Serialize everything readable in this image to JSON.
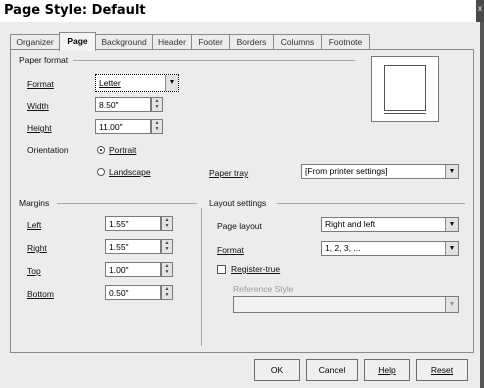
{
  "window": {
    "title": "Page Style: Default",
    "close_glyph": "x"
  },
  "tabs": [
    "Organizer",
    "Page",
    "Background",
    "Header",
    "Footer",
    "Borders",
    "Columns",
    "Footnote"
  ],
  "active_tab": "Page",
  "paper_format": {
    "section_title": "Paper format",
    "format_label": "Format",
    "format_value": "Letter",
    "width_label": "Width",
    "width_value": "8.50\"",
    "height_label": "Height",
    "height_value": "11.00\"",
    "orientation_label": "Orientation",
    "portrait_label": "Portrait",
    "landscape_label": "Landscape",
    "orientation_selected": "Portrait",
    "paper_tray_label": "Paper tray",
    "paper_tray_value": "[From printer settings]"
  },
  "margins": {
    "section_title": "Margins",
    "left_label": "Left",
    "left_value": "1.55\"",
    "right_label": "Right",
    "right_value": "1.55\"",
    "top_label": "Top",
    "top_value": "1.00\"",
    "bottom_label": "Bottom",
    "bottom_value": "0.50\""
  },
  "layout_settings": {
    "section_title": "Layout settings",
    "page_layout_label": "Page layout",
    "page_layout_value": "Right and left",
    "format_label": "Format",
    "format_value": "1, 2, 3, ...",
    "register_true_label": "Register-true",
    "register_true_checked": false,
    "reference_style_label": "Reference Style",
    "reference_style_value": ""
  },
  "buttons": {
    "ok": "OK",
    "cancel": "Cancel",
    "help": "Help",
    "reset": "Reset"
  },
  "icons": {
    "dropdown": "chevron-down-icon",
    "spin": "spin-arrows-icon"
  }
}
